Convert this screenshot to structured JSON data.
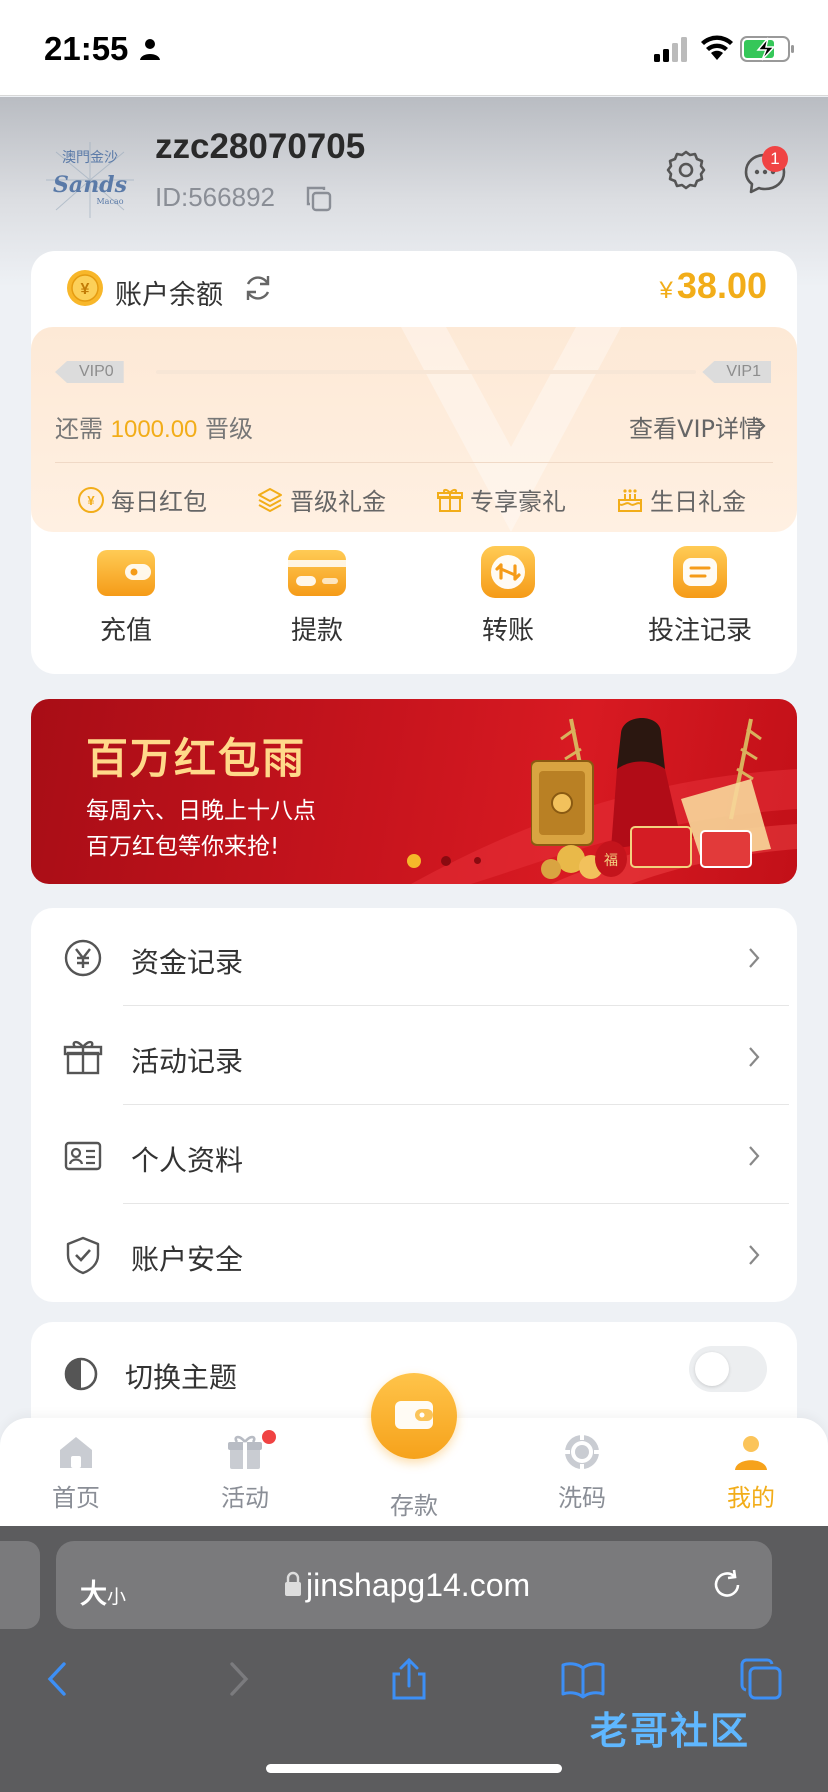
{
  "status_bar": {
    "time": "21:55"
  },
  "header": {
    "username": "zzc28070705",
    "user_id": "ID:566892",
    "message_badge": "1",
    "logo_text": "澳門金沙 Sands Macao"
  },
  "account": {
    "balance_label": "账户余额",
    "balance_currency": "¥",
    "balance_value": "38.00"
  },
  "vip": {
    "current_level": "VIP0",
    "next_level": "VIP1",
    "need_prefix": "还需",
    "need_amount": "1000.00",
    "need_suffix": "晋级",
    "detail_link": "查看VIP详情",
    "progress": 0.0,
    "perks": [
      "每日红包",
      "晋级礼金",
      "专享豪礼",
      "生日礼金"
    ]
  },
  "actions": [
    {
      "label": "充值"
    },
    {
      "label": "提款"
    },
    {
      "label": "转账"
    },
    {
      "label": "投注记录"
    }
  ],
  "banner": {
    "title": "百万红包雨",
    "line1": "每周六、日晚上十八点",
    "line2": "百万红包等你来抢!",
    "slide_index": 1,
    "slide_count": 3
  },
  "menu": [
    {
      "label": "资金记录",
      "icon": "yen-circle-icon"
    },
    {
      "label": "活动记录",
      "icon": "gift-icon"
    },
    {
      "label": "个人资料",
      "icon": "id-card-icon"
    },
    {
      "label": "账户安全",
      "icon": "shield-check-icon"
    }
  ],
  "theme": {
    "label": "切换主题",
    "enabled": false
  },
  "tabbar": [
    {
      "label": "首页",
      "icon": "home-icon"
    },
    {
      "label": "活动",
      "icon": "gift-icon",
      "badge": true
    },
    {
      "label": "存款",
      "icon": "wallet-icon"
    },
    {
      "label": "洗码",
      "icon": "chip-icon"
    },
    {
      "label": "我的",
      "icon": "user-icon",
      "active": true
    }
  ],
  "browser": {
    "text_size_big": "大",
    "text_size_small": "小",
    "url": "jinshapg14.com"
  },
  "watermark": "老哥社区",
  "colors": {
    "accent": "#f2ad19",
    "badge": "#f04343",
    "banner": "#c7141d"
  }
}
